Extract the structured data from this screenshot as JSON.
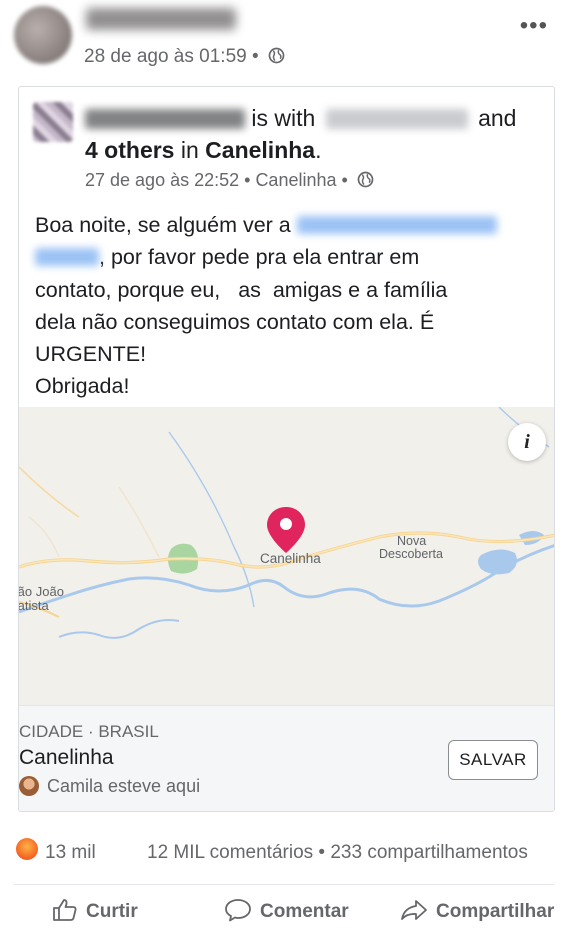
{
  "post": {
    "timestamp": "28 de ago às 01:59 •",
    "more_icon": "more-icon"
  },
  "shared": {
    "with_text": "is with",
    "and_text": "and",
    "others_text": "4 others",
    "in_text": "in",
    "location": "Canelinha",
    "period": ".",
    "meta": "27 de ago às 22:52 • Canelinha •",
    "text_line1_start": "Boa noite, se alguém ver a",
    "text_line2_end": ", por favor pede pra ela entrar em",
    "text_line3": "contato, porque eu,   as  amigas e a família",
    "text_line4": "dela não conseguimos contato com ela. É",
    "text_line5": "URGENTE!",
    "text_line6": "Obrigada!"
  },
  "map": {
    "labels": {
      "canelinha": "Canelinha",
      "nova_descoberta_1": "Nova",
      "nova_descoberta_2": "Descoberta",
      "sao_joao_1": "São João",
      "sao_joao_2": "Batista"
    },
    "info_label": "i",
    "pin_color": "#e0245e"
  },
  "place": {
    "kind": "CIDADE · BRASIL",
    "name": "Canelinha",
    "visitor": "Camila esteve aqui",
    "save_label": "SALVAR"
  },
  "stats": {
    "reactions": "13 mil",
    "comments_shares": "12 MIL comentários • 233 compartilhamentos"
  },
  "actions": {
    "like": "Curtir",
    "comment": "Comentar",
    "share": "Compartilhar"
  }
}
